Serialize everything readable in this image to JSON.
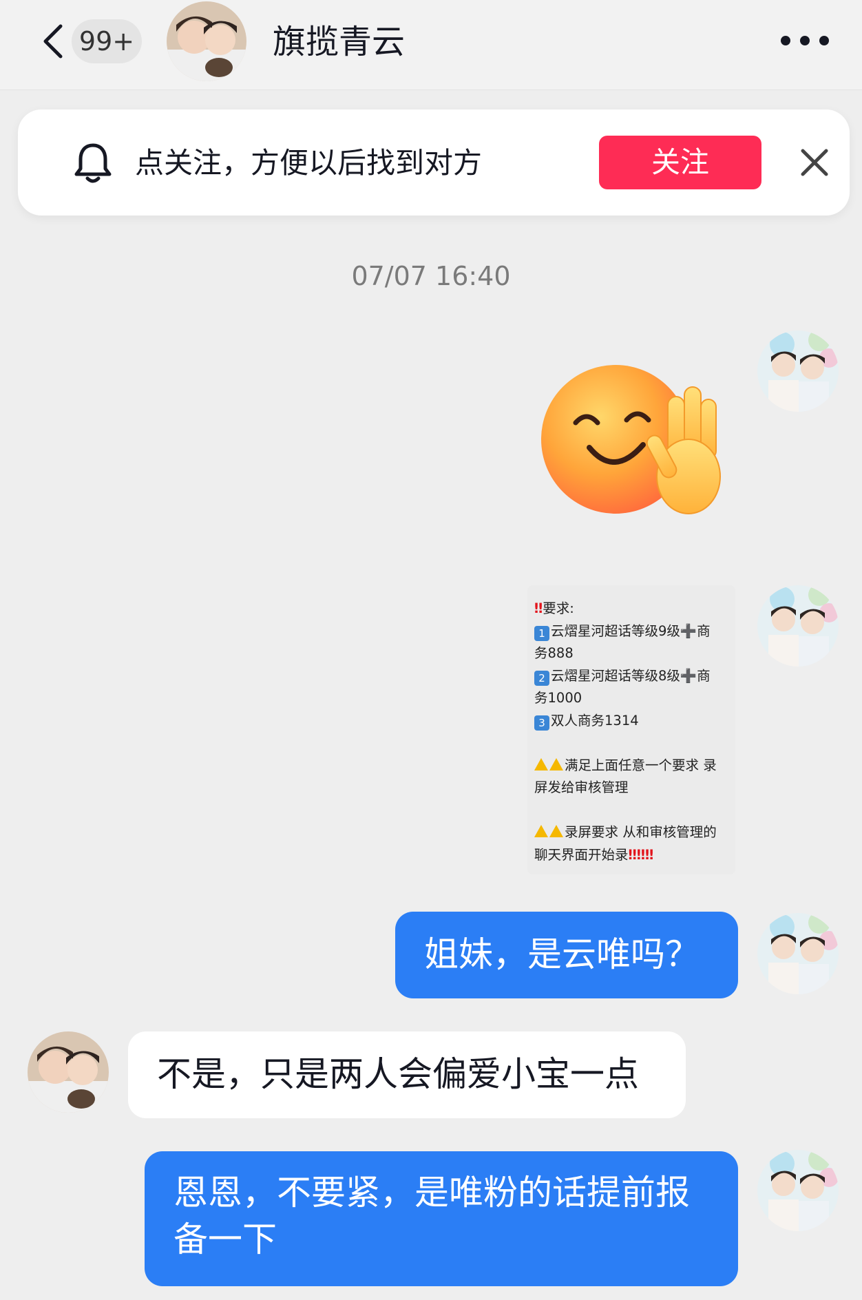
{
  "header": {
    "unread_count": "99+",
    "title": "旗揽青云"
  },
  "follow_prompt": {
    "text": "点关注，方便以后找到对方",
    "button_label": "关注"
  },
  "timestamp": "07/07 16:40",
  "messages": {
    "image_card": {
      "line1": "要求:",
      "line2a": "云熠星河超话等级9级➕商",
      "line2b": "务888",
      "line3a": "云熠星河超话等级8级➕商",
      "line3b": "务1000",
      "line4": "双人商务1314",
      "line5a": "满足上面任意一个要求 录",
      "line5b": "屏发给审核管理",
      "line6a": "录屏要求 从和审核管理的",
      "line6b": "聊天界面开始录"
    },
    "me_1": "姐妹，是云唯吗？",
    "them_1": "不是，只是两人会偏爱小宝一点",
    "me_2_line1": "恩恩，不要紧，是唯粉的话提前报",
    "me_2_line2": "备一下"
  },
  "colors": {
    "follow_button": "#fe2c55",
    "my_bubble": "#2b7ef5",
    "page_bg": "#eeeeee"
  }
}
